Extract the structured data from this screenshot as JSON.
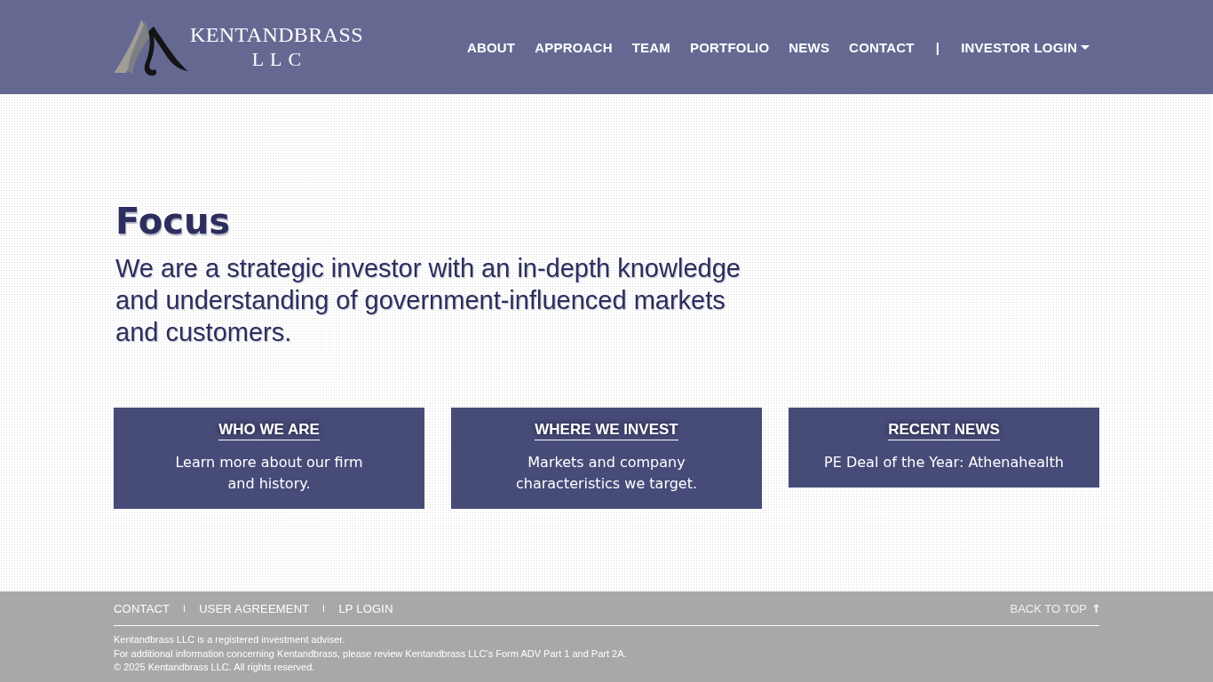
{
  "header": {
    "logo": {
      "name": "KENTANDBRASS",
      "suffix": "LLC"
    },
    "nav": [
      {
        "label": "ABOUT",
        "kind": "link"
      },
      {
        "label": "APPROACH",
        "kind": "link"
      },
      {
        "label": "TEAM",
        "kind": "link"
      },
      {
        "label": "PORTFOLIO",
        "kind": "link"
      },
      {
        "label": "NEWS",
        "kind": "link"
      },
      {
        "label": "CONTACT",
        "kind": "link"
      },
      {
        "label": "|",
        "kind": "separator"
      },
      {
        "label": "INVESTOR LOGIN",
        "kind": "dropdown"
      }
    ]
  },
  "hero": {
    "title": "Focus",
    "text": "We are a strategic investor with an in-depth knowledge and understanding of government-influenced markets and customers."
  },
  "cards": [
    {
      "title": "WHO WE ARE",
      "text": "Learn more about our firm\nand history."
    },
    {
      "title": "WHERE WE INVEST",
      "text": "Markets and company\ncharacteristics we target."
    },
    {
      "title": "RECENT NEWS",
      "text": "PE Deal of the Year: Athenahealth"
    }
  ],
  "footer": {
    "links": [
      "CONTACT",
      "USER AGREEMENT",
      "LP LOGIN"
    ],
    "back_to_top": "BACK TO TOP",
    "notes": [
      "Kentandbrass LLC is a registered investment adviser.",
      "For additional information concerning Kentandbrass, please review Kentandbrass LLC’s Form ADV Part 1 and Part 2A.",
      "© 2025 Kentandbrass LLC. All rights reserved."
    ]
  }
}
